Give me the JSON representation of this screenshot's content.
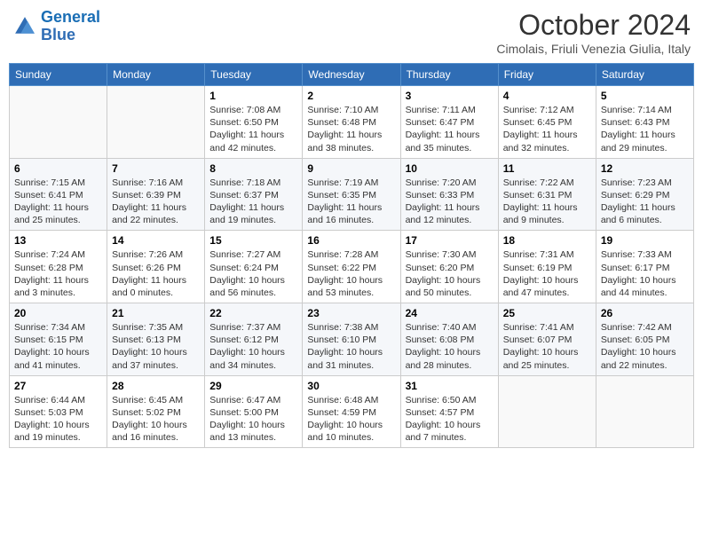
{
  "header": {
    "logo_line1": "General",
    "logo_line2": "Blue",
    "month": "October 2024",
    "location": "Cimolais, Friuli Venezia Giulia, Italy"
  },
  "days_of_week": [
    "Sunday",
    "Monday",
    "Tuesday",
    "Wednesday",
    "Thursday",
    "Friday",
    "Saturday"
  ],
  "weeks": [
    [
      {
        "day": null,
        "sunrise": null,
        "sunset": null,
        "daylight": null
      },
      {
        "day": null,
        "sunrise": null,
        "sunset": null,
        "daylight": null
      },
      {
        "day": "1",
        "sunrise": "Sunrise: 7:08 AM",
        "sunset": "Sunset: 6:50 PM",
        "daylight": "Daylight: 11 hours and 42 minutes."
      },
      {
        "day": "2",
        "sunrise": "Sunrise: 7:10 AM",
        "sunset": "Sunset: 6:48 PM",
        "daylight": "Daylight: 11 hours and 38 minutes."
      },
      {
        "day": "3",
        "sunrise": "Sunrise: 7:11 AM",
        "sunset": "Sunset: 6:47 PM",
        "daylight": "Daylight: 11 hours and 35 minutes."
      },
      {
        "day": "4",
        "sunrise": "Sunrise: 7:12 AM",
        "sunset": "Sunset: 6:45 PM",
        "daylight": "Daylight: 11 hours and 32 minutes."
      },
      {
        "day": "5",
        "sunrise": "Sunrise: 7:14 AM",
        "sunset": "Sunset: 6:43 PM",
        "daylight": "Daylight: 11 hours and 29 minutes."
      }
    ],
    [
      {
        "day": "6",
        "sunrise": "Sunrise: 7:15 AM",
        "sunset": "Sunset: 6:41 PM",
        "daylight": "Daylight: 11 hours and 25 minutes."
      },
      {
        "day": "7",
        "sunrise": "Sunrise: 7:16 AM",
        "sunset": "Sunset: 6:39 PM",
        "daylight": "Daylight: 11 hours and 22 minutes."
      },
      {
        "day": "8",
        "sunrise": "Sunrise: 7:18 AM",
        "sunset": "Sunset: 6:37 PM",
        "daylight": "Daylight: 11 hours and 19 minutes."
      },
      {
        "day": "9",
        "sunrise": "Sunrise: 7:19 AM",
        "sunset": "Sunset: 6:35 PM",
        "daylight": "Daylight: 11 hours and 16 minutes."
      },
      {
        "day": "10",
        "sunrise": "Sunrise: 7:20 AM",
        "sunset": "Sunset: 6:33 PM",
        "daylight": "Daylight: 11 hours and 12 minutes."
      },
      {
        "day": "11",
        "sunrise": "Sunrise: 7:22 AM",
        "sunset": "Sunset: 6:31 PM",
        "daylight": "Daylight: 11 hours and 9 minutes."
      },
      {
        "day": "12",
        "sunrise": "Sunrise: 7:23 AM",
        "sunset": "Sunset: 6:29 PM",
        "daylight": "Daylight: 11 hours and 6 minutes."
      }
    ],
    [
      {
        "day": "13",
        "sunrise": "Sunrise: 7:24 AM",
        "sunset": "Sunset: 6:28 PM",
        "daylight": "Daylight: 11 hours and 3 minutes."
      },
      {
        "day": "14",
        "sunrise": "Sunrise: 7:26 AM",
        "sunset": "Sunset: 6:26 PM",
        "daylight": "Daylight: 11 hours and 0 minutes."
      },
      {
        "day": "15",
        "sunrise": "Sunrise: 7:27 AM",
        "sunset": "Sunset: 6:24 PM",
        "daylight": "Daylight: 10 hours and 56 minutes."
      },
      {
        "day": "16",
        "sunrise": "Sunrise: 7:28 AM",
        "sunset": "Sunset: 6:22 PM",
        "daylight": "Daylight: 10 hours and 53 minutes."
      },
      {
        "day": "17",
        "sunrise": "Sunrise: 7:30 AM",
        "sunset": "Sunset: 6:20 PM",
        "daylight": "Daylight: 10 hours and 50 minutes."
      },
      {
        "day": "18",
        "sunrise": "Sunrise: 7:31 AM",
        "sunset": "Sunset: 6:19 PM",
        "daylight": "Daylight: 10 hours and 47 minutes."
      },
      {
        "day": "19",
        "sunrise": "Sunrise: 7:33 AM",
        "sunset": "Sunset: 6:17 PM",
        "daylight": "Daylight: 10 hours and 44 minutes."
      }
    ],
    [
      {
        "day": "20",
        "sunrise": "Sunrise: 7:34 AM",
        "sunset": "Sunset: 6:15 PM",
        "daylight": "Daylight: 10 hours and 41 minutes."
      },
      {
        "day": "21",
        "sunrise": "Sunrise: 7:35 AM",
        "sunset": "Sunset: 6:13 PM",
        "daylight": "Daylight: 10 hours and 37 minutes."
      },
      {
        "day": "22",
        "sunrise": "Sunrise: 7:37 AM",
        "sunset": "Sunset: 6:12 PM",
        "daylight": "Daylight: 10 hours and 34 minutes."
      },
      {
        "day": "23",
        "sunrise": "Sunrise: 7:38 AM",
        "sunset": "Sunset: 6:10 PM",
        "daylight": "Daylight: 10 hours and 31 minutes."
      },
      {
        "day": "24",
        "sunrise": "Sunrise: 7:40 AM",
        "sunset": "Sunset: 6:08 PM",
        "daylight": "Daylight: 10 hours and 28 minutes."
      },
      {
        "day": "25",
        "sunrise": "Sunrise: 7:41 AM",
        "sunset": "Sunset: 6:07 PM",
        "daylight": "Daylight: 10 hours and 25 minutes."
      },
      {
        "day": "26",
        "sunrise": "Sunrise: 7:42 AM",
        "sunset": "Sunset: 6:05 PM",
        "daylight": "Daylight: 10 hours and 22 minutes."
      }
    ],
    [
      {
        "day": "27",
        "sunrise": "Sunrise: 6:44 AM",
        "sunset": "Sunset: 5:03 PM",
        "daylight": "Daylight: 10 hours and 19 minutes."
      },
      {
        "day": "28",
        "sunrise": "Sunrise: 6:45 AM",
        "sunset": "Sunset: 5:02 PM",
        "daylight": "Daylight: 10 hours and 16 minutes."
      },
      {
        "day": "29",
        "sunrise": "Sunrise: 6:47 AM",
        "sunset": "Sunset: 5:00 PM",
        "daylight": "Daylight: 10 hours and 13 minutes."
      },
      {
        "day": "30",
        "sunrise": "Sunrise: 6:48 AM",
        "sunset": "Sunset: 4:59 PM",
        "daylight": "Daylight: 10 hours and 10 minutes."
      },
      {
        "day": "31",
        "sunrise": "Sunrise: 6:50 AM",
        "sunset": "Sunset: 4:57 PM",
        "daylight": "Daylight: 10 hours and 7 minutes."
      },
      {
        "day": null,
        "sunrise": null,
        "sunset": null,
        "daylight": null
      },
      {
        "day": null,
        "sunrise": null,
        "sunset": null,
        "daylight": null
      }
    ]
  ]
}
